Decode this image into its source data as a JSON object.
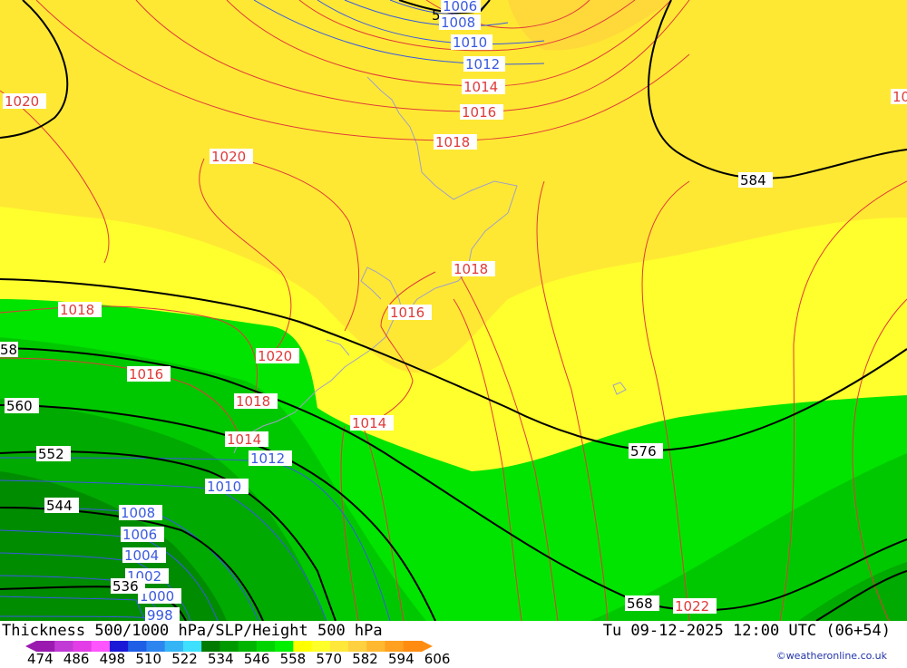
{
  "title": {
    "left": "Thickness 500/1000 hPa/SLP/Height 500 hPa",
    "right": "Tu 09-12-2025 12:00 UTC (06+54)"
  },
  "credit": "©weatheronline.co.uk",
  "legend": {
    "ticks": [
      "474",
      "486",
      "498",
      "510",
      "522",
      "534",
      "546",
      "558",
      "570",
      "582",
      "594",
      "606"
    ],
    "colors": [
      "#9a1ab0",
      "#c13ad6",
      "#e23de6",
      "#ff55ff",
      "#1a1ad6",
      "#1f5fe6",
      "#2d86f0",
      "#35b5f5",
      "#3fe0ff",
      "#007a00",
      "#009a00",
      "#00b400",
      "#00d400",
      "#00f000",
      "#ffff00",
      "#ffff2a",
      "#ffe83a",
      "#ffd040",
      "#ffb830",
      "#ffa020",
      "#ff8c10"
    ]
  },
  "isobars": [
    "1006",
    "1008",
    "1010",
    "1012",
    "1014",
    "1016",
    "1018",
    "1020",
    "1020",
    "1018",
    "1018",
    "1016",
    "1016",
    "1020",
    "1018",
    "1016",
    "1014",
    "1014",
    "1012",
    "1010",
    "1008",
    "1006",
    "1004",
    "1002",
    "1000",
    "998",
    "1022",
    "10"
  ],
  "thickness_labels": [
    "58",
    "560",
    "552",
    "544",
    "536",
    "584",
    "576",
    "568"
  ],
  "height_label_top": "5"
}
